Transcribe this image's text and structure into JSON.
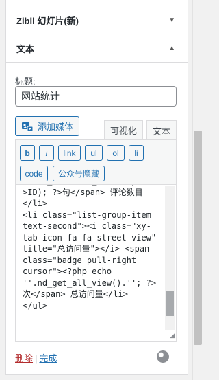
{
  "widgets": {
    "slideshow_title": "Zibll 幻灯片(新)",
    "text_title": "文本"
  },
  "form": {
    "title_label": "标题:",
    "title_value": "网站统计"
  },
  "toolbar": {
    "add_media_label": "添加媒体",
    "tab_visual": "可视化",
    "tab_text": "文本",
    "quicktags": [
      "b",
      "i",
      "link",
      "ul",
      "ol",
      "li",
      "code",
      "公众号隐藏"
    ]
  },
  "editor": {
    "content": "frame_comments_users($post\n>ID); ?>句</span> 评论数目\n</li>\n<li class=\"list-group-item\ntext-second\"><i class=\"xy-\ntab-icon fa fa-street-view\"\ntitle=\"总访问量\"></i> <span\nclass=\"badge pull-right\ncursor\"><?php echo\n''.nd_get_all_view().''; ?>\n次</span> 总访问量</li>\n</ul>"
  },
  "footer": {
    "delete_label": "删除",
    "separator": "|",
    "done_label": "完成"
  },
  "colors": {
    "accent": "#2271b1",
    "danger": "#b32d2e"
  }
}
